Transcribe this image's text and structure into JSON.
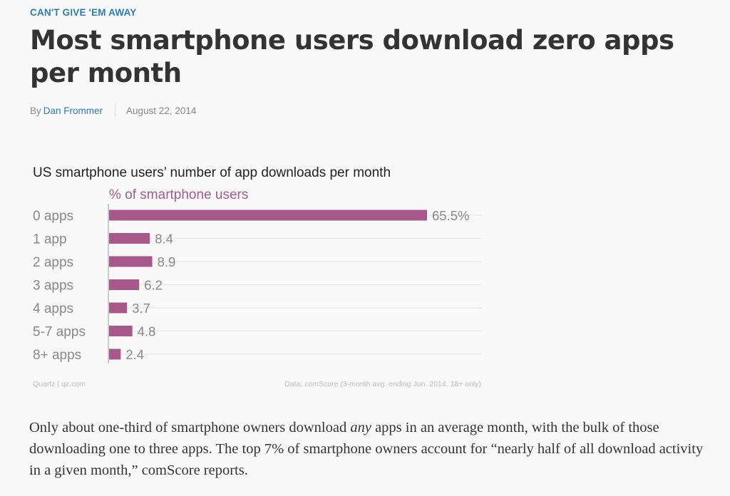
{
  "article": {
    "kicker": "CAN'T GIVE 'EM AWAY",
    "headline": "Most smartphone users download zero apps per month",
    "byline_prefix": "By",
    "author": "Dan Frommer",
    "date": "August 22, 2014"
  },
  "chart_data": {
    "type": "bar",
    "orientation": "horizontal",
    "title": "US smartphone users’ number of app downloads per month",
    "subtitle": "% of smartphone users",
    "categories": [
      "0 apps",
      "1 app",
      "2 apps",
      "3 apps",
      "4 apps",
      "5-7 apps",
      "8+ apps"
    ],
    "values": [
      65.5,
      8.4,
      8.9,
      6.2,
      3.7,
      4.8,
      2.4
    ],
    "value_labels": [
      "65.5%",
      "8.4",
      "8.9",
      "6.2",
      "3.7",
      "4.8",
      "2.4"
    ],
    "xlim": [
      0,
      65.5
    ],
    "bar_color": "#a8598a",
    "grid": true,
    "source_left": "Quartz | qz.com",
    "source_right": "Data: comScore (3-month avg. ending Jun. 2014, 18+ only)"
  },
  "body": {
    "p1_before": "Only about one-third of smartphone owners download ",
    "p1_em": "any",
    "p1_after": " apps in an average month, with the bulk of those downloading one to three apps. The top 7% of smartphone owners account for “nearly half of all download activity in a given month,” comScore reports."
  }
}
